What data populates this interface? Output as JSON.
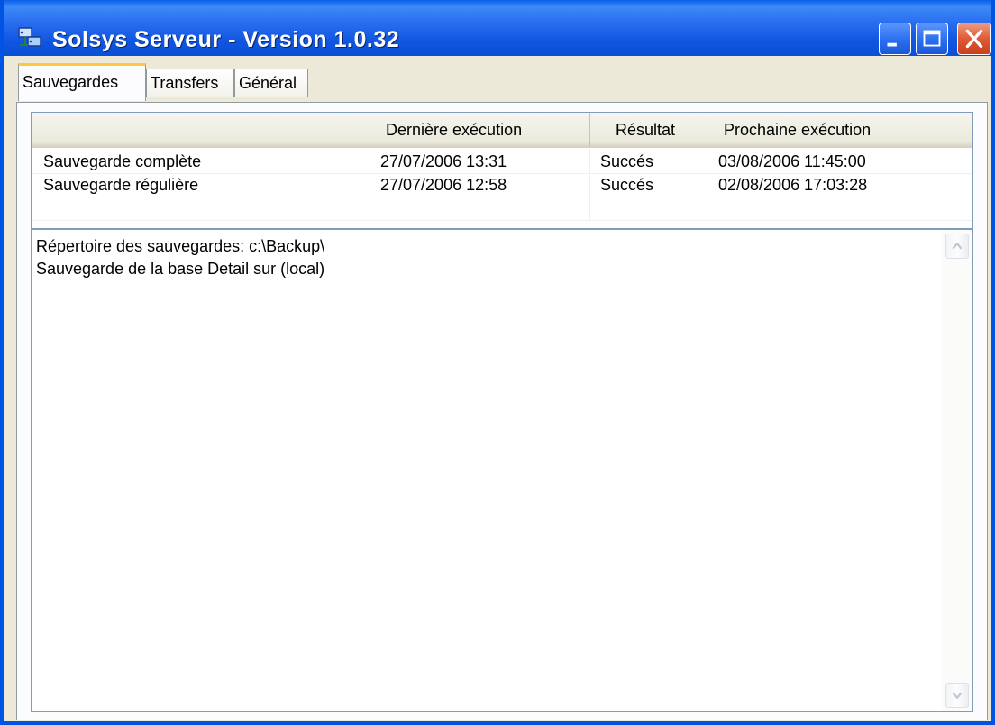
{
  "window": {
    "title": "Solsys Serveur - Version 1.0.32",
    "app_icon": "server-network-icon",
    "controls": [
      "minimize-icon",
      "maximize-icon",
      "close-icon"
    ]
  },
  "tabs": [
    {
      "label": "Sauvegardes",
      "active": true
    },
    {
      "label": "Transfers",
      "active": false
    },
    {
      "label": "Général",
      "active": false
    }
  ],
  "backups_table": {
    "columns": [
      "",
      "Dernière exécution",
      "Résultat",
      "Prochaine exécution"
    ],
    "rows": [
      [
        "Sauvegarde complète",
        "27/07/2006 13:31",
        "Succés",
        "03/08/2006 11:45:00"
      ],
      [
        "Sauvegarde régulière",
        "27/07/2006 12:58",
        "Succés",
        "02/08/2006 17:03:28"
      ]
    ]
  },
  "log": {
    "lines": [
      "Répertoire des sauvegardes: c:\\Backup\\",
      "Sauvegarde de la base Detail sur (local)"
    ]
  },
  "colors": {
    "titlebar": "#2a6ef0",
    "frame": "#0054e3",
    "dialog_bg": "#ece9d8",
    "active_tab_highlight": "#ffc83c",
    "close_button": "#e05a36"
  }
}
